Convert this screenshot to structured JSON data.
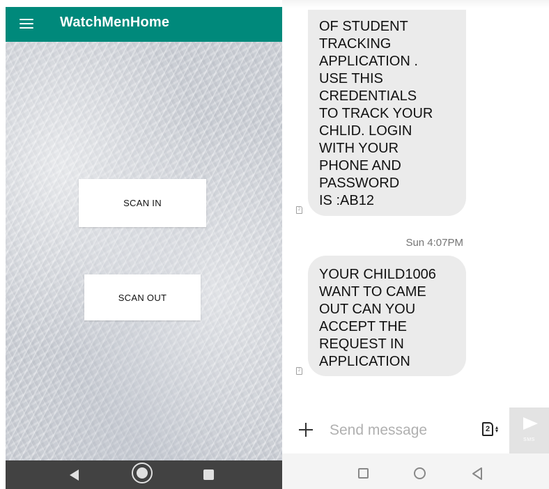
{
  "left_app": {
    "title": "WatchMenHome",
    "scan_in_label": "SCAN IN",
    "scan_out_label": "SCAN OUT"
  },
  "messages": {
    "bubble_1_text": "OF STUDENT\nTRACKING\nAPPLICATION .\nUSE THIS\nCREDENTIALS\nTO TRACK YOUR\nCHLID. LOGIN\nWITH YOUR\nPHONE AND\nPASSWORD\nIS :AB12",
    "timestamp": "Sun 4:07PM",
    "bubble_2_text": "YOUR CHILD1006\nWANT TO CAME\nOUT CAN YOU\nACCEPT THE\nREQUEST IN\nAPPLICATION",
    "sim_slot": "2"
  },
  "composer": {
    "placeholder": "Send message",
    "sim_selected": "2",
    "send_label": "SMS"
  },
  "colors": {
    "app_bar": "#00897b",
    "left_nav": "#424242",
    "bubble": "#ebebeb"
  },
  "icons": {
    "menu": "hamburger-menu-icon",
    "back": "back-triangle-icon",
    "home": "home-circle-icon",
    "recent": "recent-apps-square-icon",
    "attach": "plus-icon",
    "sim": "sim-card-icon",
    "send": "send-arrow-icon"
  }
}
